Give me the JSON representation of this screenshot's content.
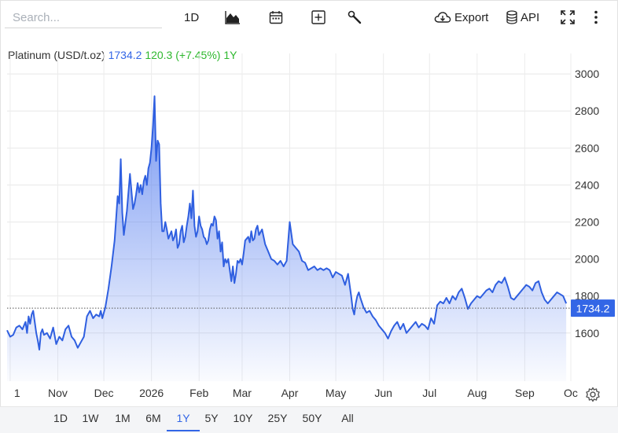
{
  "toolbar": {
    "search_placeholder": "Search...",
    "interval_label": "1D",
    "chart_type_icon": "area-chart-icon",
    "calendar_icon": "calendar-icon",
    "compare_icon": "plus-square-icon",
    "tools_icon": "wrench-icon",
    "export_label": "Export",
    "export_icon": "cloud-download-icon",
    "api_label": "API",
    "api_icon": "database-icon",
    "fullscreen_icon": "fullscreen-icon",
    "more_icon": "kebab-menu-icon"
  },
  "header": {
    "name": "Platinum (USD/t.oz)",
    "price": "1734.2",
    "change": "120.3 (+7.45%)",
    "period": "1Y"
  },
  "ranges": {
    "items": [
      "1D",
      "1W",
      "1M",
      "6M",
      "1Y",
      "5Y",
      "10Y",
      "25Y",
      "50Y",
      "All"
    ],
    "active": "1Y"
  },
  "settings_icon": "gear-icon",
  "colors": {
    "line": "#2f5fe0",
    "fill_top": "#5f85f0",
    "up": "#2eb82e",
    "price_tag": "#3366e6"
  },
  "chart_data": {
    "type": "area",
    "title": "Platinum (USD/t.oz)",
    "xlabel": "",
    "ylabel": "",
    "ylim": [
      1340,
      3060
    ],
    "yticks": [
      1600,
      1800,
      2000,
      2200,
      2400,
      2600,
      2800,
      3000
    ],
    "xticks": [
      {
        "label": "1",
        "x": 0
      },
      {
        "label": "Nov",
        "x": 31
      },
      {
        "label": "Dec",
        "x": 61
      },
      {
        "label": "2026",
        "x": 92
      },
      {
        "label": "Feb",
        "x": 123
      },
      {
        "label": "Mar",
        "x": 151
      },
      {
        "label": "Apr",
        "x": 182
      },
      {
        "label": "May",
        "x": 212
      },
      {
        "label": "Jun",
        "x": 243
      },
      {
        "label": "Jul",
        "x": 273
      },
      {
        "label": "Aug",
        "x": 304
      },
      {
        "label": "Sep",
        "x": 335
      },
      {
        "label": "Oc",
        "x": 365
      }
    ],
    "last_price": 1734.2,
    "reference_line": 1734.2,
    "grid": true,
    "x": [
      -2,
      0,
      2,
      4,
      6,
      8,
      10,
      11,
      12,
      13,
      14,
      15,
      16,
      17,
      18,
      19,
      20,
      21,
      22,
      24,
      26,
      28,
      30,
      32,
      34,
      36,
      38,
      40,
      42,
      44,
      46,
      48,
      50,
      52,
      54,
      56,
      58,
      59,
      60,
      62,
      64,
      66,
      68,
      70,
      71,
      72,
      73,
      74,
      76,
      78,
      80,
      81,
      82,
      83,
      84,
      85,
      86,
      87,
      88,
      89,
      90,
      91,
      92,
      93,
      94,
      95,
      96,
      97,
      98,
      99,
      100,
      101,
      102,
      103,
      104,
      105,
      106,
      107,
      108,
      109,
      110,
      111,
      112,
      113,
      114,
      115,
      116,
      117,
      118,
      119,
      120,
      121,
      122,
      123,
      124,
      125,
      126,
      127,
      128,
      129,
      130,
      131,
      132,
      133,
      134,
      135,
      136,
      137,
      138,
      139,
      140,
      141,
      142,
      143,
      144,
      145,
      146,
      147,
      148,
      149,
      150,
      151,
      152,
      153,
      154,
      155,
      156,
      157,
      158,
      159,
      160,
      161,
      162,
      164,
      166,
      168,
      170,
      172,
      174,
      176,
      178,
      180,
      182,
      184,
      186,
      188,
      190,
      192,
      194,
      196,
      198,
      200,
      202,
      204,
      206,
      208,
      210,
      212,
      214,
      216,
      218,
      220,
      222,
      223,
      224,
      225,
      226,
      227,
      228,
      230,
      232,
      234,
      236,
      238,
      240,
      242,
      244,
      246,
      248,
      250,
      252,
      254,
      256,
      258,
      260,
      262,
      264,
      266,
      268,
      270,
      272,
      274,
      276,
      278,
      280,
      282,
      284,
      286,
      288,
      290,
      292,
      294,
      296,
      298,
      300,
      302,
      304,
      306,
      308,
      310,
      312,
      314,
      316,
      318,
      320,
      322,
      324,
      326,
      328,
      330,
      332,
      334,
      336,
      338,
      340,
      342,
      344,
      346,
      348,
      350,
      352,
      354,
      356,
      358,
      360,
      362
    ],
    "y": [
      1615,
      1580,
      1590,
      1630,
      1640,
      1620,
      1660,
      1600,
      1690,
      1650,
      1700,
      1720,
      1660,
      1600,
      1560,
      1510,
      1600,
      1620,
      1590,
      1600,
      1570,
      1630,
      1540,
      1580,
      1560,
      1620,
      1640,
      1580,
      1560,
      1520,
      1550,
      1580,
      1690,
      1720,
      1680,
      1700,
      1690,
      1720,
      1680,
      1740,
      1840,
      1960,
      2100,
      2340,
      2300,
      2540,
      2250,
      2130,
      2260,
      2460,
      2270,
      2300,
      2350,
      2410,
      2360,
      2400,
      2350,
      2420,
      2450,
      2400,
      2490,
      2520,
      2600,
      2720,
      2880,
      2530,
      2640,
      2620,
      2300,
      2150,
      2150,
      2200,
      2160,
      2110,
      2130,
      2150,
      2100,
      2120,
      2160,
      2060,
      2080,
      2150,
      2180,
      2090,
      2120,
      2180,
      2230,
      2300,
      2220,
      2370,
      2180,
      2120,
      2150,
      2230,
      2180,
      2160,
      2120,
      2110,
      2080,
      2100,
      2160,
      2190,
      2180,
      2230,
      2210,
      2110,
      2150,
      2040,
      2090,
      1960,
      2000,
      1980,
      2000,
      1940,
      1880,
      1960,
      1870,
      1920,
      1990,
      1980,
      2000,
      1970,
      2030,
      2100,
      2110,
      2120,
      2090,
      2150,
      2100,
      2110,
      2160,
      2180,
      2130,
      2160,
      2080,
      2040,
      2000,
      1990,
      1970,
      1990,
      1960,
      1990,
      2200,
      2080,
      2060,
      2040,
      1990,
      1980,
      1940,
      1950,
      1960,
      1940,
      1950,
      1940,
      1950,
      1940,
      1900,
      1930,
      1920,
      1910,
      1860,
      1920,
      1800,
      1730,
      1700,
      1760,
      1800,
      1820,
      1790,
      1740,
      1710,
      1720,
      1690,
      1670,
      1640,
      1620,
      1600,
      1570,
      1610,
      1640,
      1660,
      1620,
      1650,
      1600,
      1620,
      1640,
      1660,
      1630,
      1650,
      1640,
      1620,
      1680,
      1650,
      1750,
      1770,
      1760,
      1790,
      1760,
      1800,
      1780,
      1820,
      1840,
      1790,
      1730,
      1760,
      1780,
      1800,
      1790,
      1810,
      1830,
      1840,
      1820,
      1860,
      1880,
      1870,
      1900,
      1850,
      1790,
      1780,
      1800,
      1820,
      1840,
      1860,
      1850,
      1830,
      1870,
      1880,
      1820,
      1780,
      1760,
      1780,
      1800,
      1820,
      1810,
      1800,
      1760,
      1750,
      1734.2
    ]
  }
}
